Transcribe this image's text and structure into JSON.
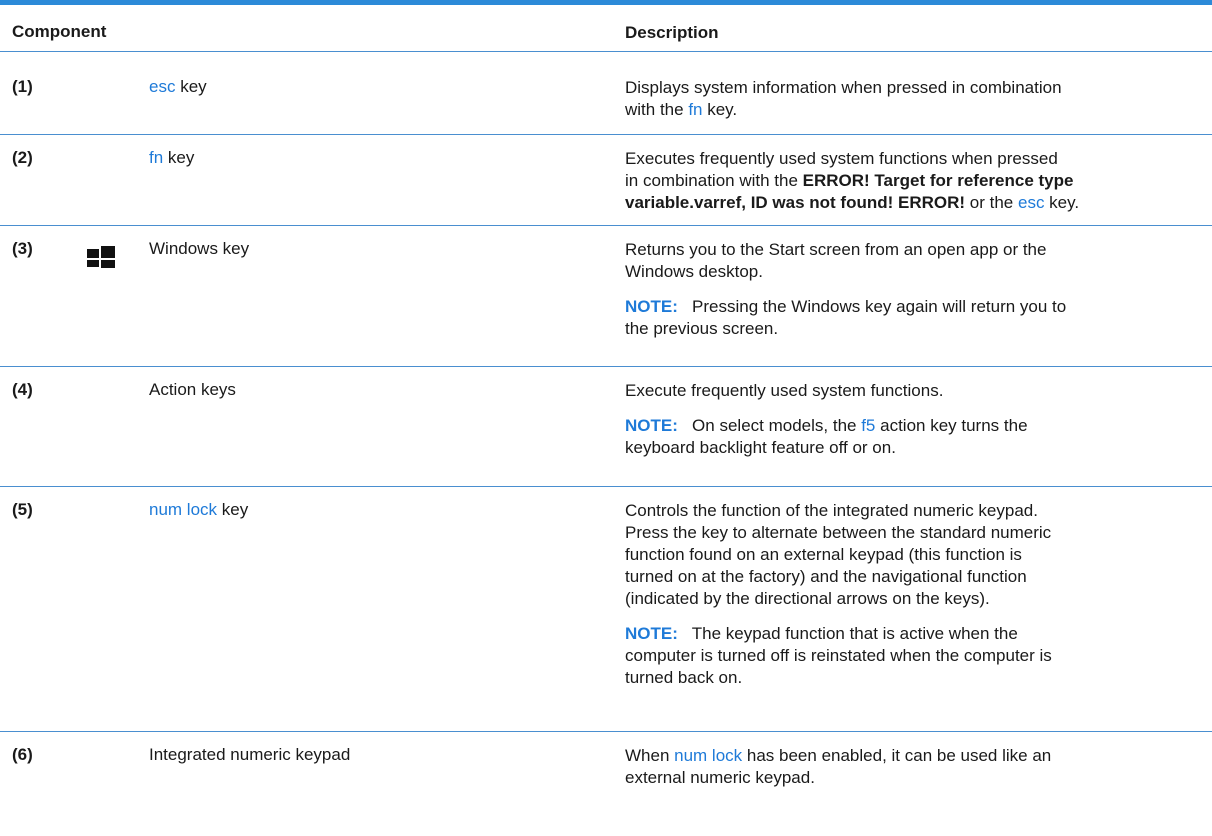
{
  "header": {
    "component": "Component",
    "description": "Description"
  },
  "rows": [
    {
      "num": "(1)",
      "name_key": "esc",
      "name_rest": " key",
      "d1": "Displays system information when pressed in combination",
      "d2a": "with the ",
      "d2k": "fn",
      "d2b": " key."
    },
    {
      "num": "(2)",
      "name_key": "fn",
      "name_rest": " key",
      "d1": "Executes frequently used system functions when pressed",
      "d2a": "in combination with the ",
      "d2b": "ERROR! Target for reference type",
      "d3a": "variable.varref, ID was not found! ERROR!",
      "d3b": " or the ",
      "d3k": "esc",
      "d3c": " key."
    },
    {
      "num": "(3)",
      "icon": "windows-logo-icon",
      "name": "Windows key",
      "d1": "Returns you to the Start screen from an open app or the",
      "d2": "Windows desktop.",
      "note_label": "NOTE:",
      "n1": "   Pressing the Windows key again will return you to",
      "n2": "the previous screen."
    },
    {
      "num": "(4)",
      "name": "Action keys",
      "d1": "Execute frequently used system functions.",
      "note_label": "NOTE:",
      "n1a": "   On select models, the ",
      "n1k": "f5",
      "n1b": " action key turns the",
      "n2": "keyboard backlight feature off or on."
    },
    {
      "num": "(5)",
      "name_key": "num lock",
      "name_rest": " key",
      "d1": "Controls the function of the integrated numeric keypad.",
      "d2": "Press the key to alternate between the standard numeric",
      "d3": "function found on an external keypad (this function is",
      "d4": "turned on at the factory) and the navigational function",
      "d5": "(indicated by the directional arrows on the keys).",
      "note_label": "NOTE:",
      "n1": "   The keypad function that is active when the",
      "n2": "computer is turned off is reinstated when the computer is",
      "n3": "turned back on."
    },
    {
      "num": "(6)",
      "name": "Integrated numeric keypad",
      "d1a": "When ",
      "d1k": "num lock",
      "d1b": " has been enabled, it can be used like an",
      "d2": "external numeric keypad."
    }
  ]
}
